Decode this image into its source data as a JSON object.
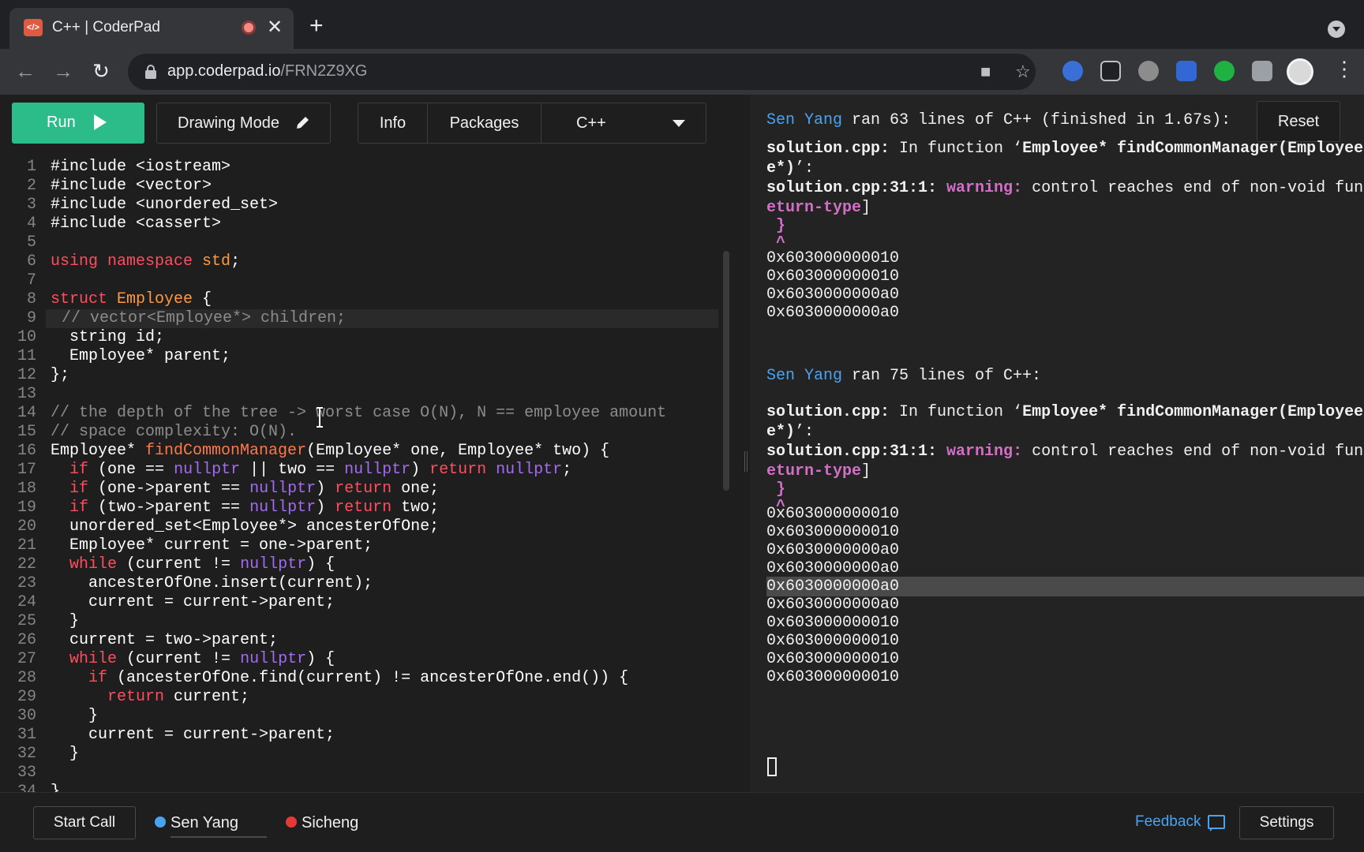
{
  "browser": {
    "tab_title": "C++ | CoderPad",
    "tab_favicon": "</>",
    "new_tab": "+",
    "url_host": "app.coderpad.io",
    "url_path": "/FRN2Z9XG"
  },
  "editor_toolbar": {
    "run_label": "Run",
    "drawing_mode_label": "Drawing Mode",
    "info_label": "Info",
    "packages_label": "Packages",
    "language_label": "C++"
  },
  "code": {
    "lines": [
      {
        "n": "1",
        "html": "#include &lt;iostream&gt;"
      },
      {
        "n": "2",
        "html": "#include &lt;vector&gt;"
      },
      {
        "n": "3",
        "html": "#include &lt;unordered_set&gt;"
      },
      {
        "n": "4",
        "html": "#include &lt;cassert&gt;"
      },
      {
        "n": "5",
        "html": ""
      },
      {
        "n": "6",
        "html": "<span class='kw'>using namespace</span> <span class='ty'>std</span>;"
      },
      {
        "n": "7",
        "html": ""
      },
      {
        "n": "8",
        "html": "<span class='kw'>struct</span> <span class='ty'>Employee</span> {"
      },
      {
        "n": "9",
        "html": "<span class='cm'>// vector&lt;Employee*&gt; children;</span>",
        "highlight": true
      },
      {
        "n": "10",
        "html": "  string id;"
      },
      {
        "n": "11",
        "html": "  Employee* parent;"
      },
      {
        "n": "12",
        "html": "};"
      },
      {
        "n": "13",
        "html": ""
      },
      {
        "n": "14",
        "html": "<span class='cm'>// the depth of the tree -&gt; worst case O(N), N == employee amount</span>"
      },
      {
        "n": "15",
        "html": "<span class='cm'>// space complexity: O(N).</span>"
      },
      {
        "n": "16",
        "html": "Employee* <span class='fn'>findCommonManager</span>(Employee* one, Employee* two) {"
      },
      {
        "n": "17",
        "html": "  <span class='kw'>if</span> (one == <span class='nl'>nullptr</span> || two == <span class='nl'>nullptr</span>) <span class='kw'>return</span> <span class='nl'>nullptr</span>;"
      },
      {
        "n": "18",
        "html": "  <span class='kw'>if</span> (one-&gt;parent == <span class='nl'>nullptr</span>) <span class='kw'>return</span> one;"
      },
      {
        "n": "19",
        "html": "  <span class='kw'>if</span> (two-&gt;parent == <span class='nl'>nullptr</span>) <span class='kw'>return</span> two;"
      },
      {
        "n": "20",
        "html": "  unordered_set&lt;Employee*&gt; ancesterOfOne;"
      },
      {
        "n": "21",
        "html": "  Employee* current = one-&gt;parent;"
      },
      {
        "n": "22",
        "html": "  <span class='kw'>while</span> (current != <span class='nl'>nullptr</span>) {"
      },
      {
        "n": "23",
        "html": "    ancesterOfOne.insert(current);"
      },
      {
        "n": "24",
        "html": "    current = current-&gt;parent;"
      },
      {
        "n": "25",
        "html": "  }"
      },
      {
        "n": "26",
        "html": "  current = two-&gt;parent;"
      },
      {
        "n": "27",
        "html": "  <span class='kw'>while</span> (current != <span class='nl'>nullptr</span>) {"
      },
      {
        "n": "28",
        "html": "    <span class='kw'>if</span> (ancesterOfOne.find(current) != ancesterOfOne.end()) {"
      },
      {
        "n": "29",
        "html": "      <span class='kw'>return</span> current;"
      },
      {
        "n": "30",
        "html": "    }"
      },
      {
        "n": "31",
        "html": "    current = current-&gt;parent;"
      },
      {
        "n": "32",
        "html": "  }"
      },
      {
        "n": "33",
        "html": ""
      },
      {
        "n": "34",
        "html": "}"
      }
    ]
  },
  "output": {
    "reset_label": "Reset",
    "run1_user": "Sen Yang",
    "run1_text": " ran 63 lines of C++ (finished in 1.67s):",
    "run2_user": "Sen Yang",
    "run2_text": " ran 75 lines of C++:",
    "file_label": "solution.cpp:",
    "in_function": " In function ‘",
    "func_sig": "Employee* findCommonManager(Employee",
    "func_sig_tail": "e*)",
    "func_close": "’:",
    "loc_label": "solution.cpp:31:1:",
    "warning_label": " warning:",
    "warning_text": " control reaches end of non-void fun",
    "warning_tail": "eturn-type",
    "brace": " }",
    "caret": " ^",
    "addresses1": [
      "0x603000000010",
      "0x603000000010",
      "0x6030000000a0",
      "0x6030000000a0"
    ],
    "addresses2": [
      "0x603000000010",
      "0x603000000010",
      "0x6030000000a0",
      "0x6030000000a0",
      "0x6030000000a0",
      "0x6030000000a0",
      "0x603000000010",
      "0x603000000010",
      "0x603000000010",
      "0x603000000010"
    ]
  },
  "bottom": {
    "start_call_label": "Start Call",
    "user1": "Sen Yang",
    "user2": "Sicheng",
    "feedback_label": "Feedback",
    "settings_label": "Settings",
    "user1_color": "#4aa3f0",
    "user2_color": "#e53935"
  }
}
